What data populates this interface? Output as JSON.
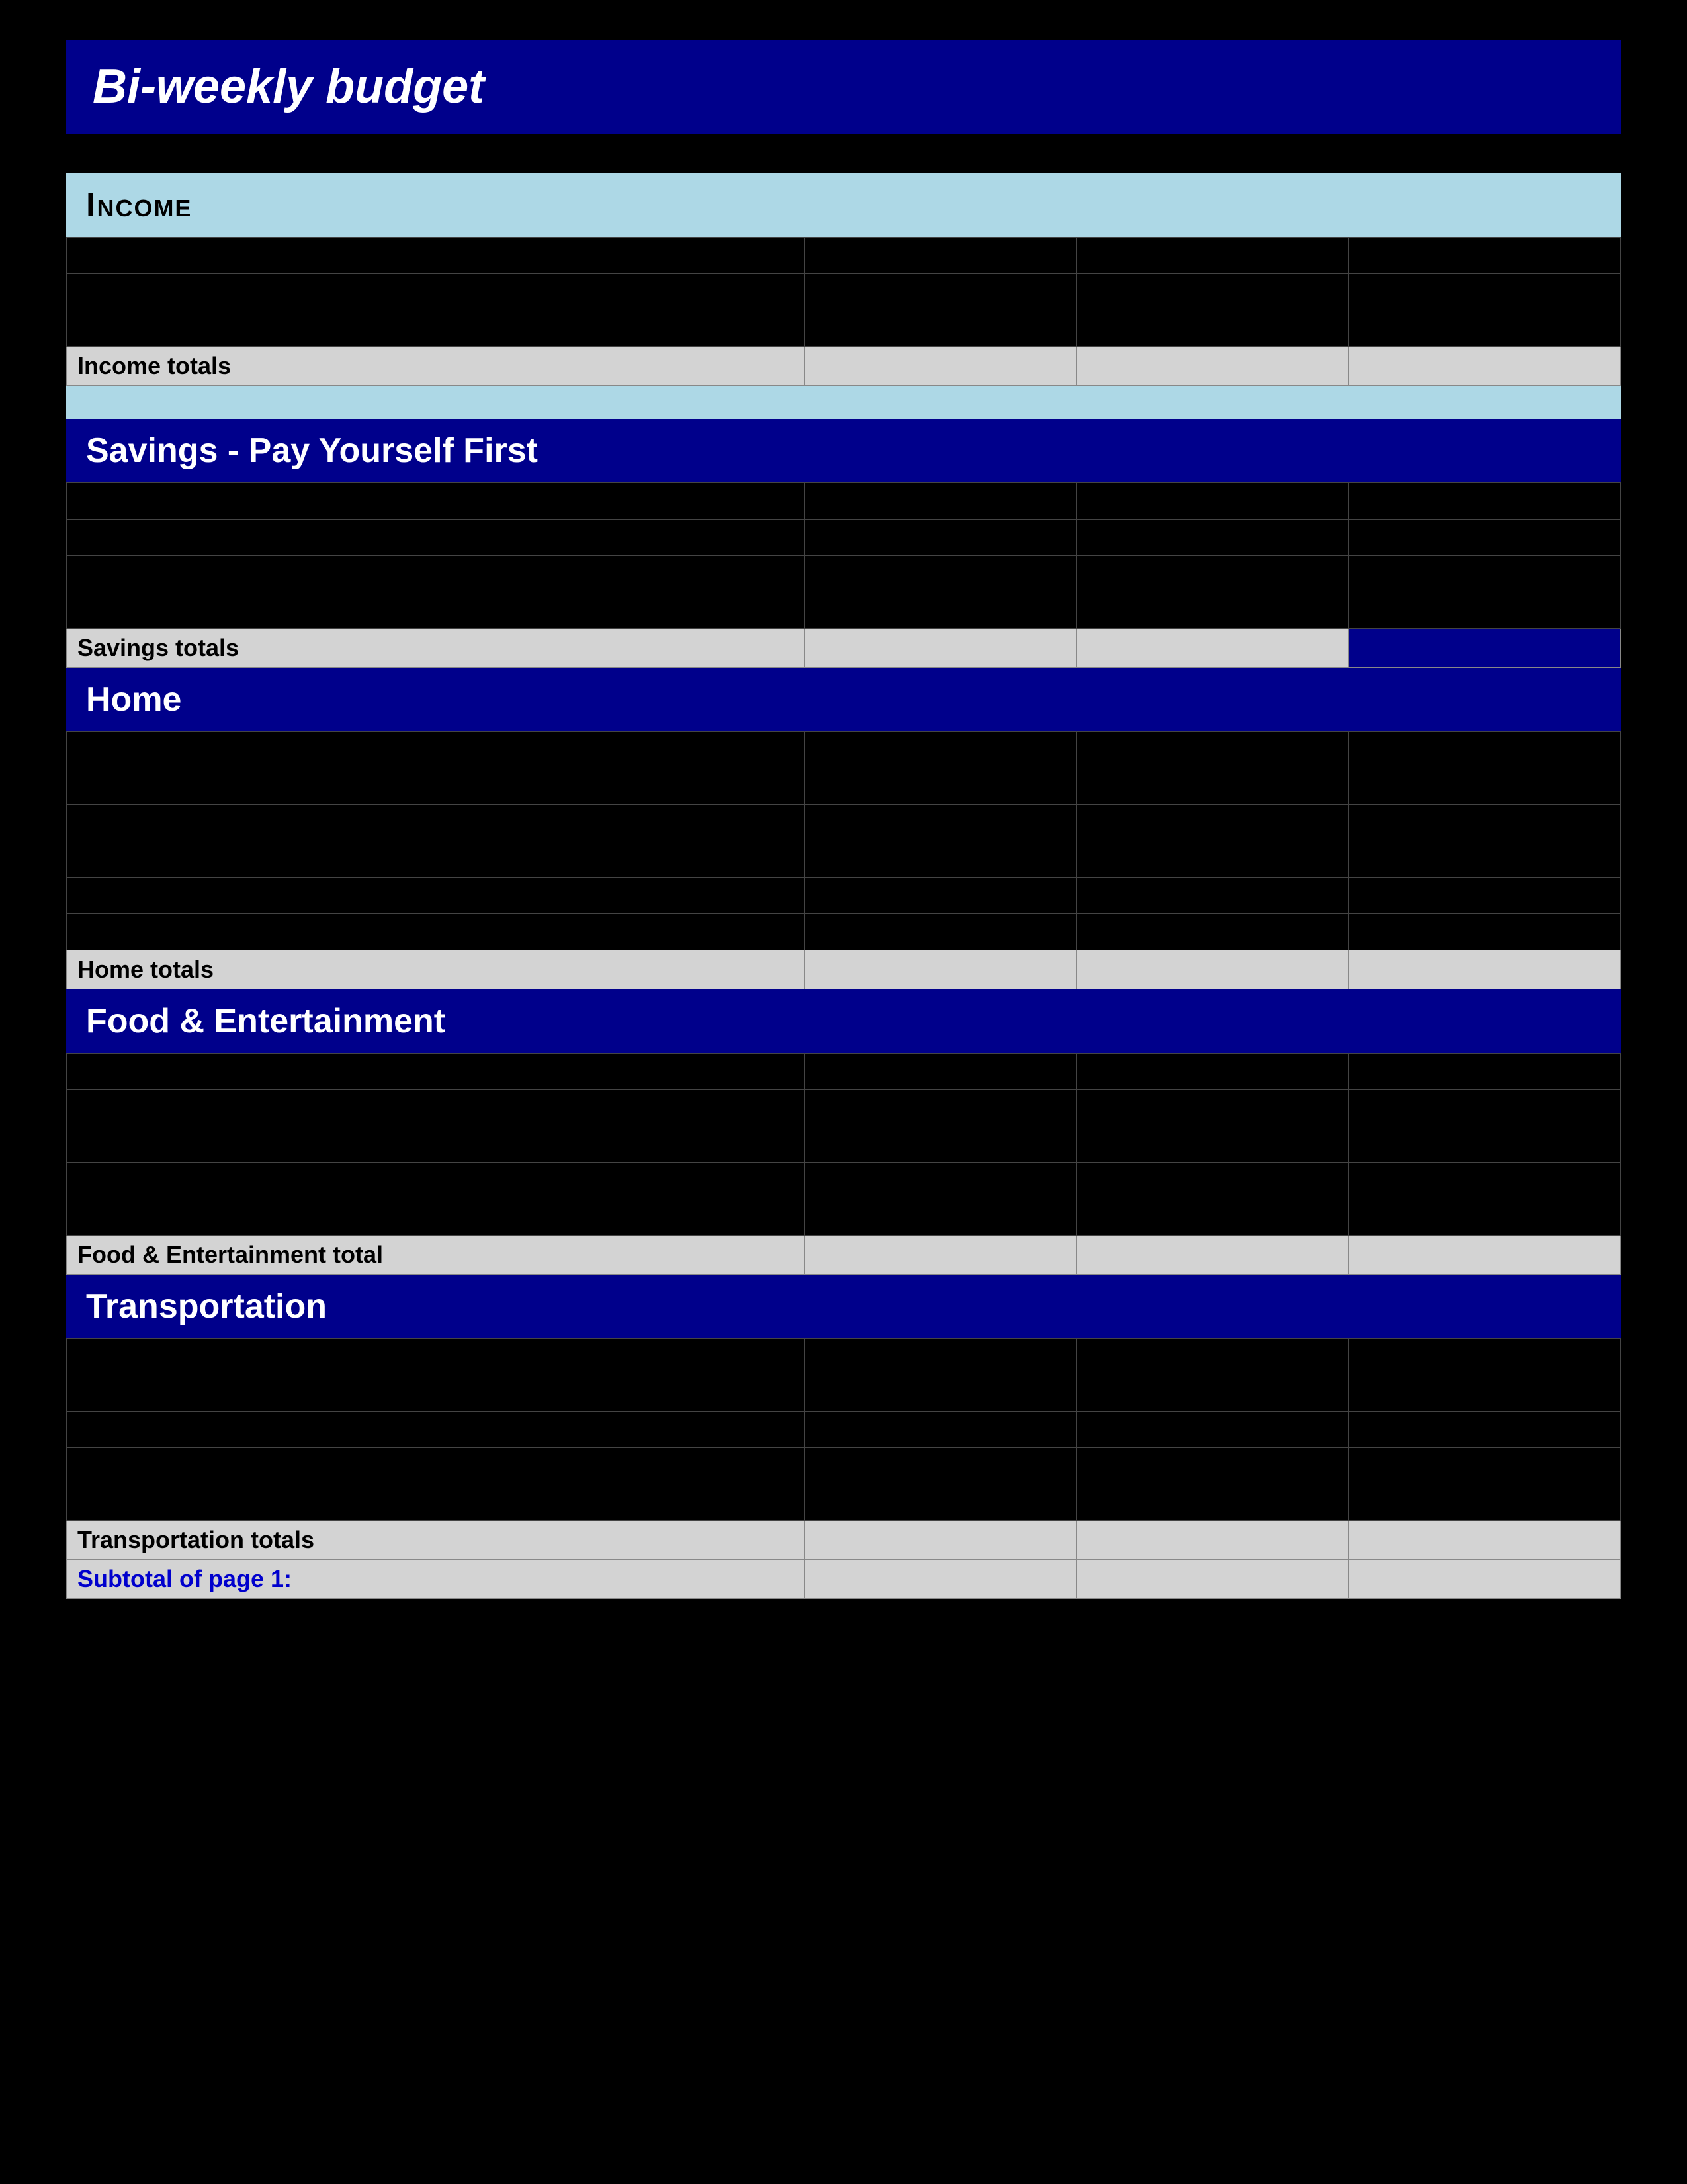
{
  "page": {
    "title": "Bi-weekly  budget"
  },
  "sections": {
    "income": {
      "title": "Income",
      "totals_label": "Income totals"
    },
    "savings": {
      "title": "Savings - Pay Yourself First",
      "totals_label": "Savings totals"
    },
    "home": {
      "title": "Home",
      "totals_label": "Home totals"
    },
    "food": {
      "title": "Food & Entertainment",
      "totals_label": "Food & Entertainment total"
    },
    "transportation": {
      "title": "Transportation",
      "totals_label": "Transportation totals"
    },
    "subtotal": {
      "label": "Subtotal of page 1:"
    }
  },
  "empty_cell": "",
  "num_empty_rows": {
    "income": 3,
    "savings": 4,
    "home": 6,
    "food": 5,
    "transportation": 5
  }
}
